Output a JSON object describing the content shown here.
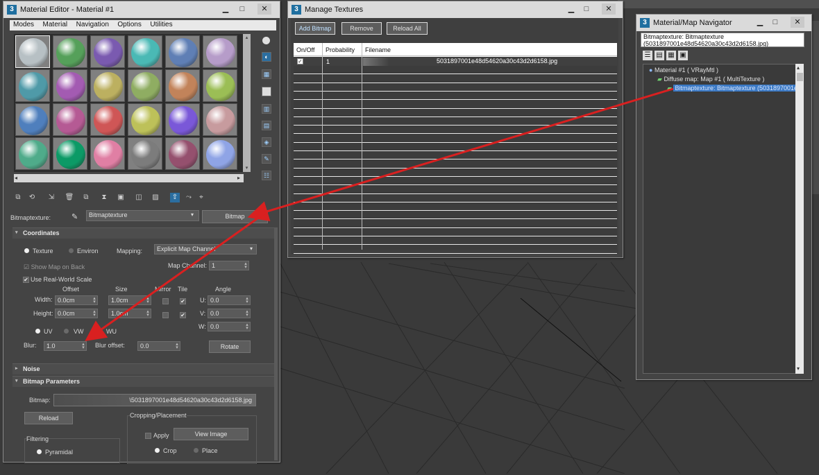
{
  "material_editor": {
    "title": "Material Editor - Material #1",
    "menu": [
      "Modes",
      "Material",
      "Navigation",
      "Options",
      "Utilities"
    ],
    "sphere_colors": [
      "#b7c0c4",
      "#55a05a",
      "#7a5ab0",
      "#4ab9b5",
      "#5f7fb5",
      "#b69cc9",
      "#4f9aa8",
      "#a35bb2",
      "#bcb060",
      "#8fad62",
      "#c2835a",
      "#9bbe55",
      "#4f7fbd",
      "#b55a94",
      "#cf5656",
      "#bdc159",
      "#7a58d8",
      "#c79b9e",
      "#4fab8a",
      "#0c9a66",
      "#e07fa4",
      "#7c7c7c",
      "#95506e",
      "#8fa4e6"
    ],
    "map_type_label": "Bitmaptexture:",
    "map_name": "Bitmaptexture",
    "map_type_button": "Bitmap",
    "coordinates": {
      "title": "Coordinates",
      "texture": "Texture",
      "environ": "Environ",
      "mapping_label": "Mapping:",
      "mapping_value": "Explicit Map Channel",
      "map_channel_label": "Map Channel:",
      "map_channel_value": "1",
      "show_map_on_back": "Show Map on Back",
      "use_real_world_scale": "Use Real-World Scale",
      "offset": "Offset",
      "size": "Size",
      "mirror": "Mirror",
      "tile": "Tile",
      "angle": "Angle",
      "width_label": "Width:",
      "height_label": "Height:",
      "width_offset": "0.0cm",
      "width_size": "1.0cm",
      "height_offset": "0.0cm",
      "height_size": "1.0cm",
      "u_label": "U:",
      "v_label": "V:",
      "w_label": "W:",
      "u_value": "0.0",
      "v_value": "0.0",
      "w_value": "0.0",
      "uv": "UV",
      "vw": "VW",
      "wu": "WU",
      "blur_label": "Blur:",
      "blur_value": "1.0",
      "blur_offset_label": "Blur offset:",
      "blur_offset_value": "0.0",
      "rotate": "Rotate"
    },
    "noise": {
      "title": "Noise"
    },
    "bitmap_parameters": {
      "title": "Bitmap Parameters",
      "bitmap_label": "Bitmap:",
      "bitmap_path": "\\5031897001e48d54620a30c43d2d6158.jpg",
      "reload": "Reload",
      "cropping_title": "Cropping/Placement",
      "apply": "Apply",
      "view_image": "View Image",
      "crop": "Crop",
      "place": "Place",
      "filtering_title": "Filtering",
      "pyramidal": "Pyramidal"
    }
  },
  "manage_textures": {
    "title": "Manage Textures",
    "buttons": [
      "Add Bitmap",
      "Remove",
      "Reload All"
    ],
    "columns": [
      "On/Off",
      "Probability",
      "Filename"
    ],
    "rows": [
      {
        "enabled": true,
        "probability": "1",
        "filename": "5031897001e48d54620a30c43d2d6158.jpg"
      }
    ]
  },
  "navigator": {
    "title": "Material/Map Navigator",
    "path_line1": "Bitmaptexture: Bitmaptexture",
    "path_line2": "(5031897001e48d54620a30c43d2d6158.jpg)",
    "tree": [
      "Material #1  ( VRayMtl )",
      "Diffuse map: Map #1  ( MultiTexture )",
      "Bitmaptexture: Bitmaptexture (5031897001e"
    ]
  },
  "colors": {
    "arrow": "#d92020",
    "selection": "#3b79c4",
    "active_icon": "#2b6ea0"
  }
}
